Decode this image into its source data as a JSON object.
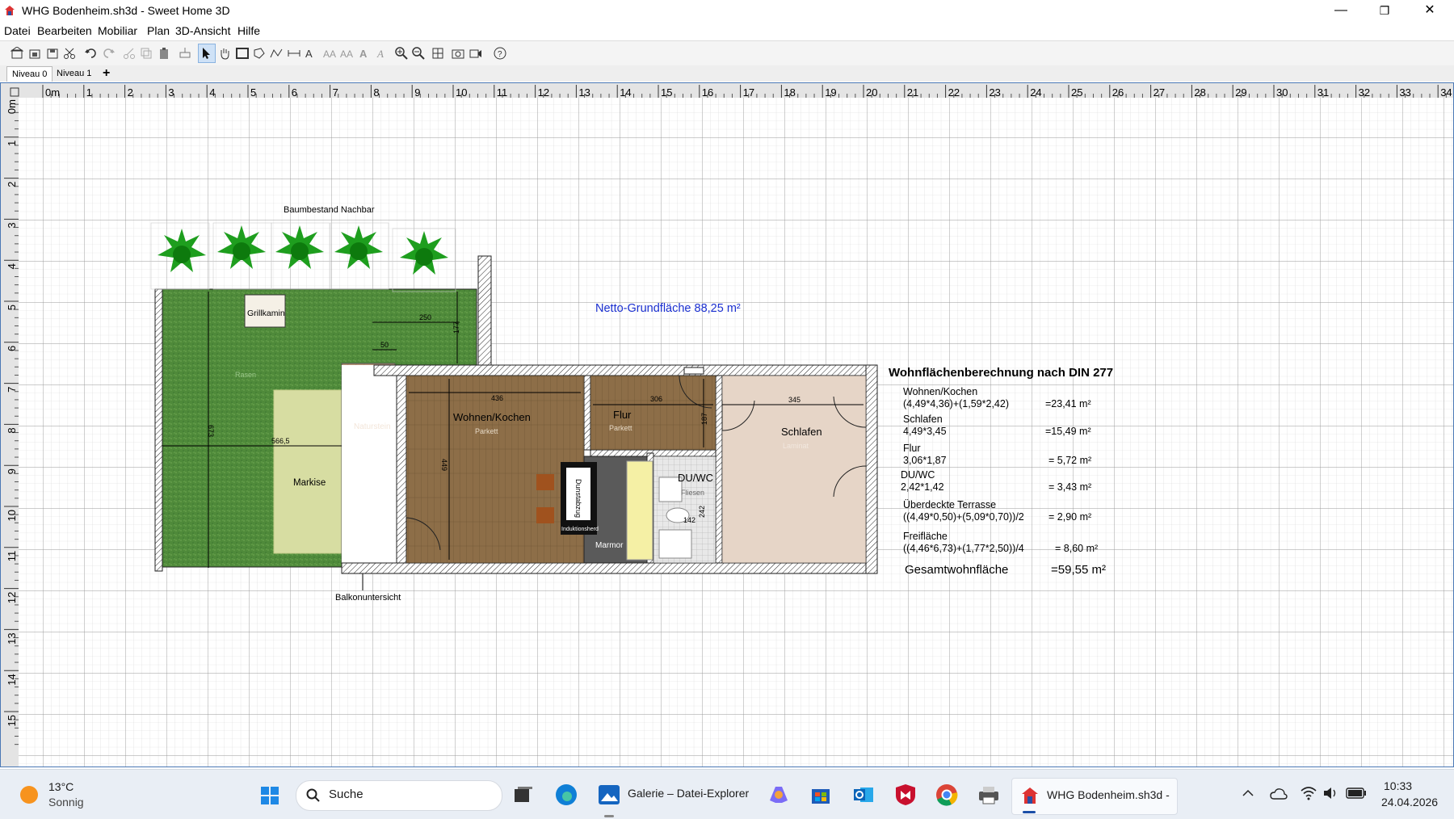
{
  "window": {
    "title": "WHG Bodenheim.sh3d - Sweet Home 3D",
    "minimize": "—",
    "maximize": "❐",
    "close": "✕"
  },
  "menu": [
    "Datei",
    "Bearbeiten",
    "Mobiliar",
    "Plan",
    "3D-Ansicht",
    "Hilfe"
  ],
  "levels": {
    "tab0": "Niveau 0",
    "tab1": "Niveau 1",
    "add": "+"
  },
  "ruler": {
    "x_labels": [
      "0m",
      "1",
      "2",
      "3",
      "4",
      "5",
      "6",
      "7",
      "8",
      "9",
      "10",
      "11",
      "12",
      "13",
      "14",
      "15",
      "16",
      "17",
      "18",
      "19",
      "20",
      "21",
      "22",
      "23",
      "24",
      "25",
      "26",
      "27",
      "28",
      "29",
      "30",
      "31",
      "32",
      "33",
      "34"
    ],
    "y_labels": [
      "0m",
      "1",
      "2",
      "3",
      "4",
      "5",
      "6",
      "7",
      "8",
      "9",
      "10",
      "11",
      "12",
      "13",
      "14",
      "15"
    ]
  },
  "plan": {
    "trees_label": "Baumbestand Nachbar",
    "grill": "Grillkamin",
    "rasen": "Rasen",
    "naturstein": "Naturstein",
    "markise": "Markise",
    "balkon": "Balkonuntersicht",
    "dims": {
      "d250": "250",
      "d177": "177",
      "d50": "50",
      "d673": "673",
      "d5665": "566,5",
      "d436": "436",
      "d449": "449",
      "d306": "306",
      "d187": "187",
      "d345": "345",
      "d242": "242",
      "d142": "142"
    },
    "rooms": {
      "wohnen": "Wohnen/Kochen",
      "wohnen_floor": "Parkett",
      "flur": "Flur",
      "flur_floor": "Parkett",
      "schlafen": "Schlafen",
      "schlafen_floor": "Laminat",
      "duwc": "DU/WC",
      "duwc_floor": "Fliesen",
      "marmor": "Marmor",
      "dunstabzug": "Dunstabzug",
      "induktion": "Induktionsherd"
    },
    "netto": "Netto-Grundfläche 88,25 m²"
  },
  "calc": {
    "title": "Wohnflächenberechnung nach DIN 277",
    "rows": [
      {
        "name": "Wohnen/Kochen",
        "formula": "(4,49*4,36)+(1,59*2,42)",
        "result": "=23,41 m²"
      },
      {
        "name": "Schlafen",
        "formula": "4,49*3,45",
        "result": "=15,49 m²"
      },
      {
        "name": "Flur",
        "formula": "3,06*1,87",
        "result": "= 5,72 m²"
      },
      {
        "name": "DU/WC",
        "formula": "2,42*1,42",
        "result": "= 3,43 m²"
      },
      {
        "name": "Überdeckte Terrasse",
        "formula": "((4,49*0,50)+(5,09*0,70))/2",
        "result": "= 2,90 m²"
      },
      {
        "name": "Freifläche",
        "formula": "((4,46*6,73)+(1,77*2,50))/4",
        "result": "= 8,60 m²"
      }
    ],
    "total_label": "Gesamtwohnfläche",
    "total_value": "=59,55 m²"
  },
  "taskbar": {
    "weather_temp": "13°C",
    "weather_desc": "Sonnig",
    "search": "Suche",
    "explorer": "Galerie – Datei-Explorer",
    "app": "WHG Bodenheim.sh3d -",
    "time": "10:33",
    "date": "24.04.2026"
  },
  "colors": {
    "accent": "#1b4fa8",
    "grass": "#4f8a3a",
    "parquet": "#8d6e48",
    "laminate": "#e6d5c7",
    "markise": "#d7dda2",
    "stone": "#b89478",
    "tree": "#1e9e1e",
    "netto": "#1a2fd0"
  }
}
